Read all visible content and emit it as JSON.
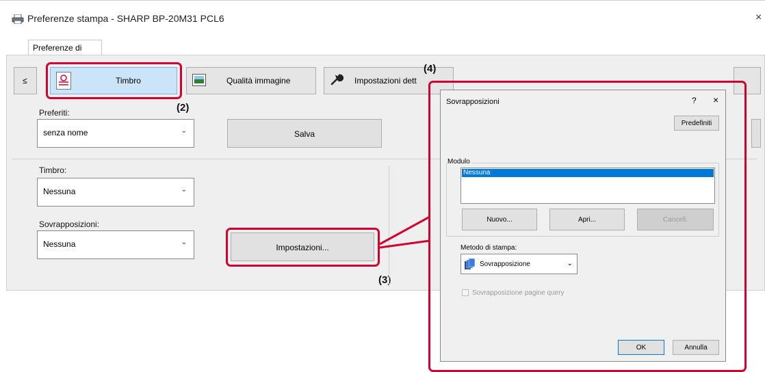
{
  "window": {
    "title": "Preferenze stampa - SHARP BP-20M31 PCL6",
    "close_glyph": "×"
  },
  "tabs": [
    {
      "label": "Preferenze di stampa"
    }
  ],
  "nav": {
    "back_label": "≤",
    "items": [
      {
        "label": "Timbro",
        "icon": "stamp-icon"
      },
      {
        "label": "Qualità immagine",
        "icon": "image-quality-icon"
      },
      {
        "label": "Impostazioni dett",
        "icon": "wrench-icon"
      }
    ]
  },
  "favorites": {
    "label": "Preferiti:",
    "value": "senza nome",
    "save_label": "Salva"
  },
  "stamp": {
    "label": "Timbro:",
    "value": "Nessuna"
  },
  "overlays": {
    "label": "Sovrapposizioni:",
    "value": "Nessuna",
    "settings_label": "Impostazioni..."
  },
  "callouts": [
    "(2)",
    "(3)",
    "(4)"
  ],
  "highlight_color": "#d1002e",
  "dialog": {
    "title": "Sovrapposizioni",
    "help_glyph": "?",
    "close_glyph": "×",
    "defaults_label": "Predefiniti",
    "module": {
      "label": "Modulo",
      "items": [
        {
          "label": "Nessuna",
          "selected": true
        }
      ],
      "new_label": "Nuovo...",
      "open_label": "Apri...",
      "delete_label": "Cancell."
    },
    "print_method": {
      "label": "Metodo di stampa:",
      "value": "Sovrapposizione"
    },
    "query_pages": {
      "label": "Sovrapposizione pagine query",
      "checked": false,
      "enabled": false
    },
    "ok_label": "OK",
    "cancel_label": "Annulla"
  }
}
